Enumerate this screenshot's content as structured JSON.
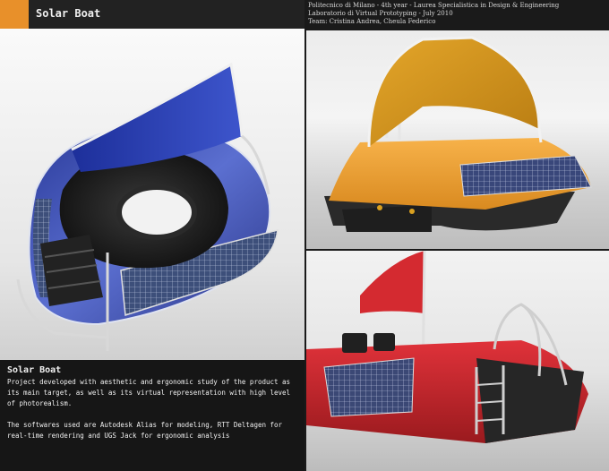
{
  "header": {
    "title": "Solar Boat",
    "accent_color": "#e8902a"
  },
  "credits": {
    "line1": "Politecnico di Milano - 4th year - Laurea Specialistica in Design & Engineering",
    "line2": "Laboratorio di Virtual Prototyping - July 2010",
    "line3": "Team: Cristina Andrea, Cheula Federico"
  },
  "description": {
    "title": "Solar Boat",
    "paragraph1": "Project developed with aesthetic and ergonomic study of the product as its main target, as well as its virtual representation with high level of photorealism.",
    "paragraph2": "The softwares used are Autodesk Alias for modeling, RTT Deltagen for real-time rendering and UGS Jack for ergonomic analysis"
  },
  "renders": {
    "main": "blue-solar-boat-render",
    "top_right": "orange-solar-boat-render",
    "bottom_right": "red-solar-boat-render"
  }
}
